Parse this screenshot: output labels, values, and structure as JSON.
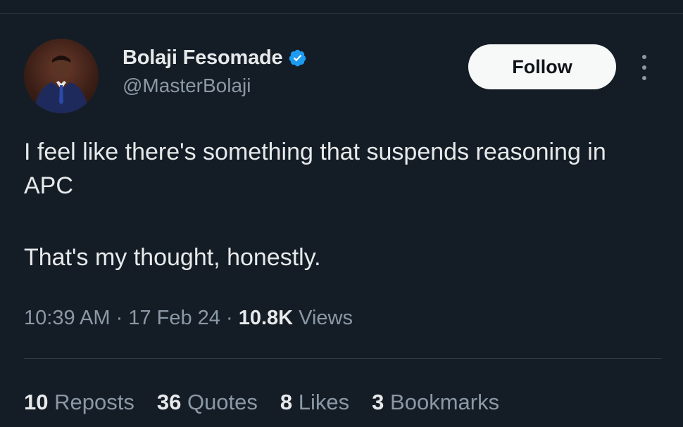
{
  "author": {
    "display_name": "Bolaji Fesomade",
    "handle": "@MasterBolaji",
    "verified": true,
    "verified_color": "#1d9bf0"
  },
  "follow_button": {
    "label": "Follow"
  },
  "tweet": {
    "line1": "I feel like there's something that suspends reasoning in APC",
    "line2": "That's my thought, honestly."
  },
  "meta": {
    "time": "10:39 AM",
    "separator": " · ",
    "date": "17 Feb 24",
    "views_count": "10.8K",
    "views_label": "Views"
  },
  "stats": {
    "reposts_count": "10",
    "reposts_label": "Reposts",
    "quotes_count": "36",
    "quotes_label": "Quotes",
    "likes_count": "8",
    "likes_label": "Likes",
    "bookmarks_count": "3",
    "bookmarks_label": "Bookmarks"
  },
  "colors": {
    "background": "#141d26",
    "text_primary": "#e7e9ea",
    "text_secondary": "#8b98a5"
  }
}
